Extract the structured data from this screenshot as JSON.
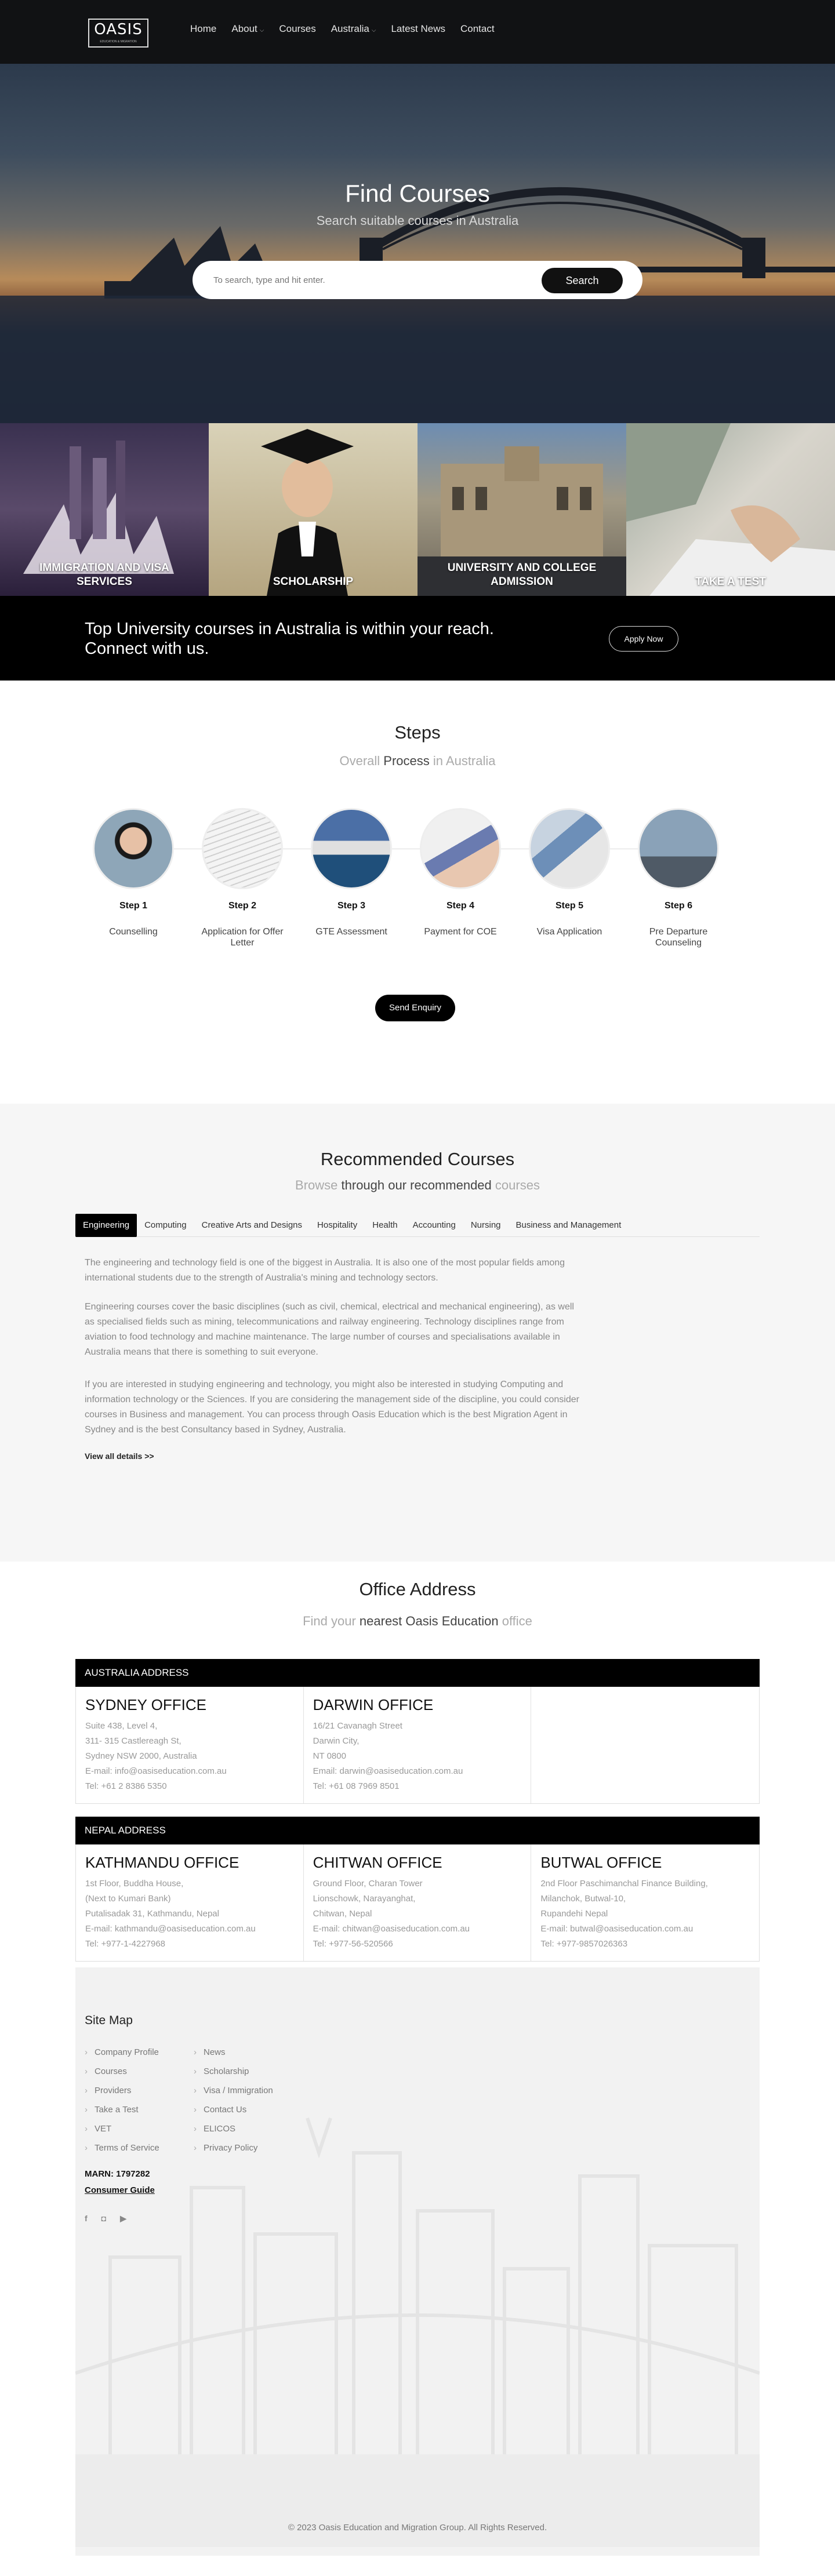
{
  "nav": {
    "logo": "OASIS",
    "logo_tagline": "EDUCATION & MIGRATION",
    "items": [
      "Home",
      "About",
      "Courses",
      "Australia",
      "Latest News",
      "Contact"
    ]
  },
  "hero": {
    "title": "Find Courses",
    "subtitle": "Search suitable courses in Australia",
    "search_placeholder": "To search, type and hit enter.",
    "search_button": "Search"
  },
  "tiles": [
    {
      "label": "Immigration and Visa Services"
    },
    {
      "label": "Scholarship"
    },
    {
      "label": "University and College Admission"
    },
    {
      "label": "Take a Test"
    }
  ],
  "cta": {
    "text": "Top University courses in Australia is within your reach. Connect with us.",
    "button": "Apply Now"
  },
  "steps": {
    "title": "Steps",
    "sub_a": "Overall",
    "sub_b": "Process",
    "sub_c": "in Australia",
    "items": [
      {
        "num": "Step 1",
        "name": "Counselling"
      },
      {
        "num": "Step 2",
        "name": "Application for Offer Letter"
      },
      {
        "num": "Step 3",
        "name": "GTE Assessment"
      },
      {
        "num": "Step 4",
        "name": "Payment for COE"
      },
      {
        "num": "Step 5",
        "name": "Visa Application"
      },
      {
        "num": "Step 6",
        "name": "Pre Departure Counseling"
      }
    ],
    "button": "Send Enquiry"
  },
  "recommended": {
    "title": "Recommended Courses",
    "sub_a": "Browse",
    "sub_b": "through our recommended",
    "sub_c": "courses",
    "tabs": [
      "Engineering",
      "Computing",
      "Creative Arts and Designs",
      "Hospitality",
      "Health",
      "Accounting",
      "Nursing",
      "Business and Management"
    ],
    "paragraphs": [
      "The engineering and technology field is one of the biggest in Australia. It is also one of the most popular fields among international students due to the strength of Australia's mining and technology sectors.",
      "Engineering courses cover the basic disciplines (such as civil, chemical, electrical and mechanical engineering), as well as specialised fields such as mining, telecommunications and railway engineering. Technology disciplines range from aviation to food technology and machine maintenance. The large number of courses and specialisations available in Australia means that there is something to suit everyone.",
      "If you are interested in studying engineering and technology, you might also be interested in studying Computing and information technology or the Sciences. If you are considering the management side of the discipline, you could consider courses in Business and management. You can process through Oasis Education which is the best Migration Agent in Sydney and is the best Consultancy based in Sydney, Australia."
    ],
    "view_all": "View all details >>"
  },
  "office": {
    "title": "Office Address",
    "sub_a": "Find your",
    "sub_b": "nearest Oasis Education",
    "sub_c": "office",
    "australia_bar": "Australia Address",
    "nepal_bar": "Nepal Address",
    "australia": [
      {
        "name": "Sydney Office",
        "lines": [
          "Suite 438, Level 4,",
          "311- 315 Castlereagh St,",
          "Sydney NSW 2000, Australia",
          "E-mail: info@oasiseducation.com.au",
          "Tel: +61 2 8386 5350"
        ]
      },
      {
        "name": "Darwin Office",
        "lines": [
          "16/21 Cavanagh Street",
          "Darwin City,",
          "NT 0800",
          "Email: darwin@oasiseducation.com.au",
          "Tel: +61 08 7969 8501"
        ]
      }
    ],
    "nepal": [
      {
        "name": "Kathmandu Office",
        "lines": [
          "1st Floor, Buddha House,",
          "(Next to Kumari Bank)",
          "Putalisadak 31, Kathmandu, Nepal",
          "E-mail: kathmandu@oasiseducation.com.au",
          "Tel: +977-1-4227968"
        ]
      },
      {
        "name": "Chitwan Office",
        "lines": [
          "Ground Floor, Charan Tower",
          "Lionschowk, Narayanghat,",
          "Chitwan, Nepal",
          "E-mail: chitwan@oasiseducation.com.au",
          "Tel: +977-56-520566"
        ]
      },
      {
        "name": "Butwal Office",
        "lines": [
          "2nd Floor Paschimanchal Finance Building,",
          "Milanchok, Butwal-10,",
          "Rupandehi Nepal",
          "E-mail: butwal@oasiseducation.com.au",
          "Tel: +977-9857026363"
        ]
      }
    ]
  },
  "footer": {
    "title": "Site Map",
    "col1": [
      "Company Profile",
      "Courses",
      "Providers",
      "Take a Test",
      "VET",
      "Terms of Service"
    ],
    "col2": [
      "News",
      "Scholarship",
      "Visa / Immigration",
      "Contact Us",
      "ELICOS",
      "Privacy Policy"
    ],
    "marn": "MARN: 1797282",
    "guide": "Consumer Guide",
    "social": [
      "f",
      "◘",
      "▶"
    ],
    "copyright": "© 2023 Oasis Education and Migration Group. All Rights Reserved."
  }
}
